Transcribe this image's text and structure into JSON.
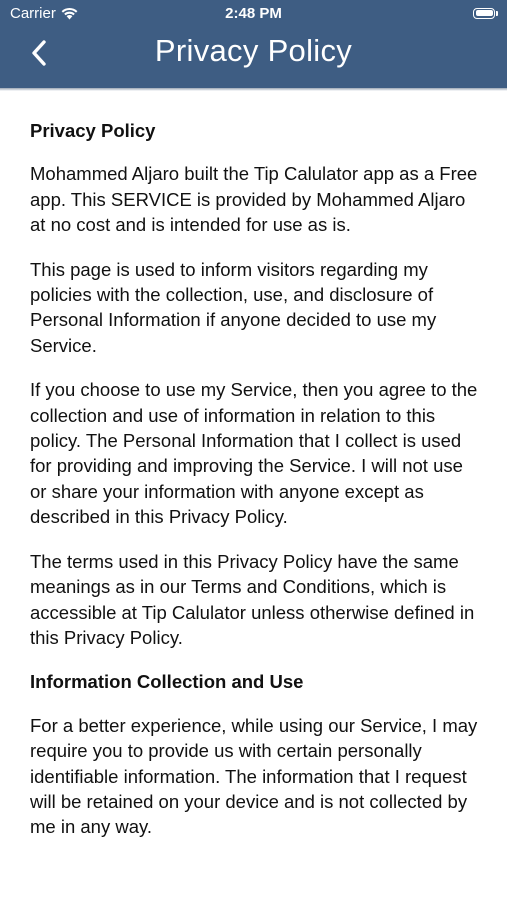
{
  "status_bar": {
    "carrier": "Carrier",
    "time": "2:48 PM"
  },
  "nav": {
    "title": "Privacy Policy",
    "back_icon": "chevron-left-icon"
  },
  "colors": {
    "nav_background": "#3e5d83",
    "text": "#111111"
  },
  "content": {
    "heading_1": "Privacy Policy",
    "paragraph_1": "Mohammed Aljaro built the Tip Calulator app as a Free app. This SERVICE is provided by Mohammed Aljaro at no cost and is intended for use as is.",
    "paragraph_2": "This page is used to inform visitors regarding my policies with the collection, use, and disclosure of Personal Information if anyone decided to use my Service.",
    "paragraph_3": "If you choose to use my Service, then you agree to the collection and use of information in relation to this policy. The Personal Information that I collect is used for providing and improving the Service. I will not use or share your information with anyone except as described in this Privacy Policy.",
    "paragraph_4": "The terms used in this Privacy Policy have the same meanings as in our Terms and Conditions, which is accessible at Tip Calulator unless otherwise defined in this Privacy Policy.",
    "heading_2": "Information Collection and Use",
    "paragraph_5": "For a better experience, while using our Service, I may require you to provide us with certain personally identifiable information. The information that I request will be retained on your device and is not collected by me in any way."
  }
}
